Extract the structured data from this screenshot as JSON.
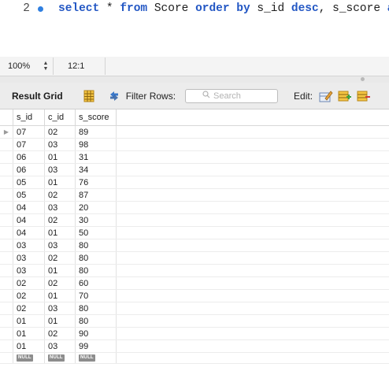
{
  "editor": {
    "line_number": "2",
    "code_tokens": [
      {
        "text": "select",
        "kind": "kw"
      },
      {
        "text": " * ",
        "kind": "ident"
      },
      {
        "text": "from",
        "kind": "kw"
      },
      {
        "text": " Score ",
        "kind": "ident"
      },
      {
        "text": "order by",
        "kind": "kw"
      },
      {
        "text": " s_id ",
        "kind": "ident"
      },
      {
        "text": "desc",
        "kind": "kw"
      },
      {
        "text": ", s_score ",
        "kind": "ident"
      },
      {
        "text": "asc",
        "kind": "kw"
      },
      {
        "text": ";",
        "kind": "ident"
      }
    ]
  },
  "status": {
    "zoom": "100%",
    "cursor_position": "12:1"
  },
  "toolbar": {
    "result_grid_label": "Result Grid",
    "filter_rows_label": "Filter Rows:",
    "search_placeholder": "Search",
    "edit_label": "Edit:"
  },
  "grid": {
    "columns": [
      "s_id",
      "c_id",
      "s_score"
    ],
    "rows": [
      [
        "07",
        "02",
        "89"
      ],
      [
        "07",
        "03",
        "98"
      ],
      [
        "06",
        "01",
        "31"
      ],
      [
        "06",
        "03",
        "34"
      ],
      [
        "05",
        "01",
        "76"
      ],
      [
        "05",
        "02",
        "87"
      ],
      [
        "04",
        "03",
        "20"
      ],
      [
        "04",
        "02",
        "30"
      ],
      [
        "04",
        "01",
        "50"
      ],
      [
        "03",
        "03",
        "80"
      ],
      [
        "03",
        "02",
        "80"
      ],
      [
        "03",
        "01",
        "80"
      ],
      [
        "02",
        "02",
        "60"
      ],
      [
        "02",
        "01",
        "70"
      ],
      [
        "02",
        "03",
        "80"
      ],
      [
        "01",
        "01",
        "80"
      ],
      [
        "01",
        "02",
        "90"
      ],
      [
        "01",
        "03",
        "99"
      ]
    ],
    "null_row": [
      "NULL",
      "NULL",
      "NULL"
    ],
    "current_row_indicator": "▶"
  },
  "colors": {
    "keyword": "#2357c4",
    "exec_dot": "#2f7fe0",
    "null_badge": "#8d8d8d"
  }
}
